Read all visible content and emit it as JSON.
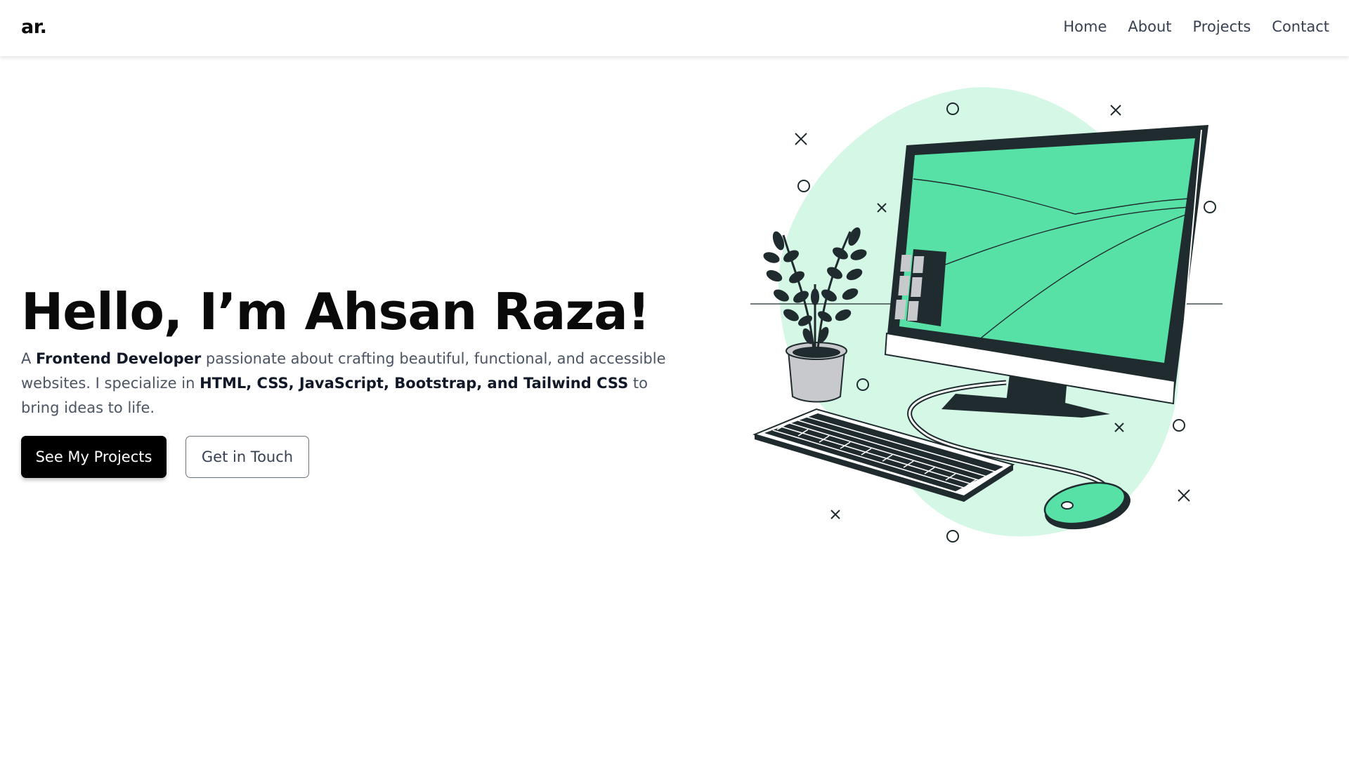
{
  "navbar": {
    "logo": "ar.",
    "links": [
      "Home",
      "About",
      "Projects",
      "Contact"
    ]
  },
  "hero": {
    "title": "Hello, I’m Ahsan Raza!",
    "desc_parts": [
      "A ",
      "Frontend Developer",
      " passionate about crafting beautiful, functional, and accessible websites. I specialize in ",
      "HTML, CSS, JavaScript, Bootstrap, and Tailwind CSS",
      " to bring ideas to life."
    ],
    "primary_button": "See My Projects",
    "secondary_button": "Get in Touch"
  },
  "colors": {
    "accent": "#57e1a6",
    "blob": "#d4f7e6",
    "dark": "#1f2b2e",
    "primary_button": "#000000"
  }
}
